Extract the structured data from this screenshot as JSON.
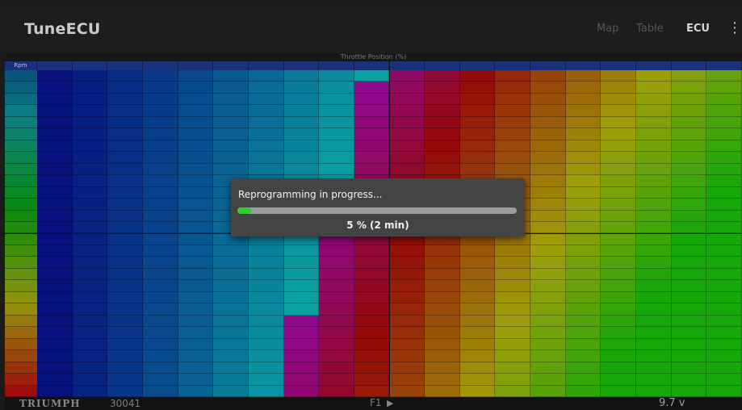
{
  "app": {
    "title": "TuneECU",
    "menu": {
      "map": "Map",
      "table": "Table",
      "ecu": "ECU"
    },
    "overflow_icon": "more-vert-icon"
  },
  "map_view": {
    "axis_title": "Throttle Position (%)",
    "corner_label": "Rpm"
  },
  "status_bar": {
    "brand": "TRIUMPH",
    "ecu_id": "30041",
    "map_slot": "F1",
    "voltage": "9.7 v"
  },
  "dialog": {
    "message": "Reprogramming in progress...",
    "progress_fraction": 0.05,
    "progress_label": "5 % (2 min)"
  },
  "colors": {
    "progress_fill": "#2ecc2e",
    "progress_track": "#9c9c9c",
    "dialog_bg": "#444444",
    "app_bar": "#222222"
  }
}
